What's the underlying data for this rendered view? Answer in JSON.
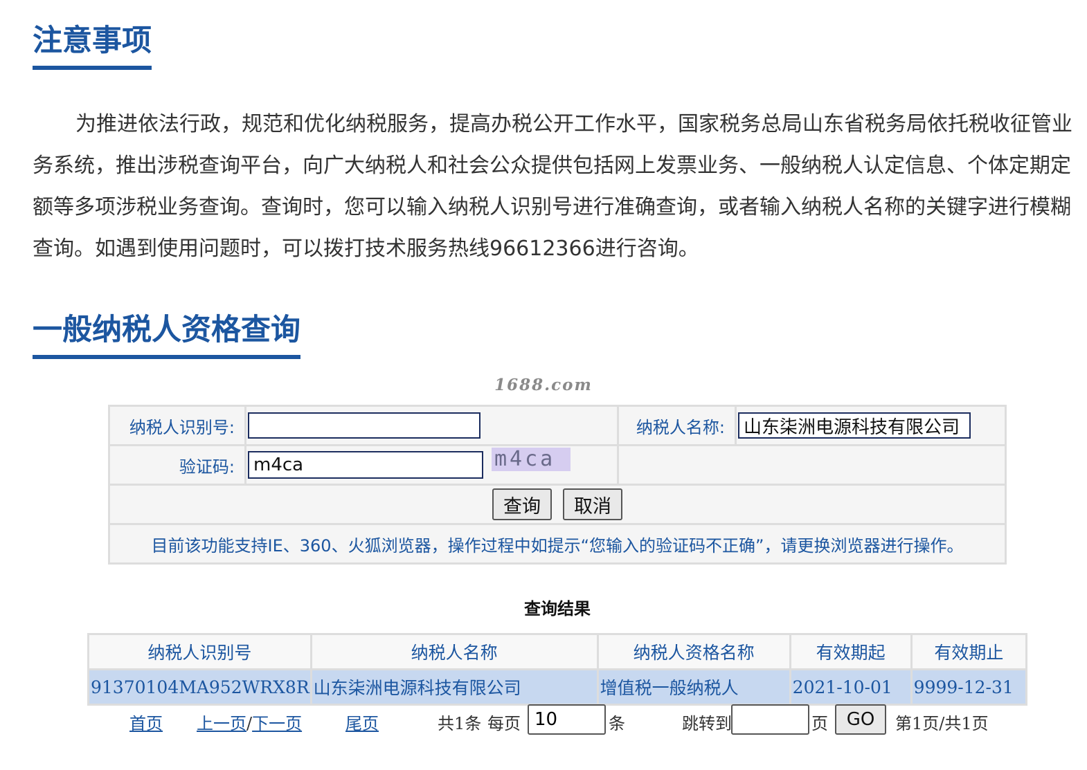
{
  "notice": {
    "title": "注意事项",
    "body": "为推进依法行政，规范和优化纳税服务，提高办税公开工作水平，国家税务总局山东省税务局依托税收征管业务系统，推出涉税查询平台，向广大纳税人和社会公众提供包括网上发票业务、一般纳税人认定信息、个体定期定额等多项涉税业务查询。查询时，您可以输入纳税人识别号进行准确查询，或者输入纳税人名称的关键字进行模糊查询。如遇到使用问题时，可以拨打技术服务热线96612366进行咨询。"
  },
  "query": {
    "title": "一般纳税人资格查询",
    "watermark": "1688.com",
    "taxpayer_id_label": "纳税人识别号:",
    "taxpayer_id_value": "",
    "taxpayer_name_label": "纳税人名称:",
    "taxpayer_name_value": "山东柒洲电源科技有限公司",
    "captcha_label": "验证码:",
    "captcha_value": "m4ca",
    "captcha_image_text": "m4ca",
    "search_button": "查询",
    "cancel_button": "取消",
    "browser_note": "目前该功能支持IE、360、火狐浏览器，操作过程中如提示“您输入的验证码不正确”，请更换浏览器进行操作。"
  },
  "results": {
    "title": "查询结果",
    "columns": [
      "纳税人识别号",
      "纳税人名称",
      "纳税人资格名称",
      "有效期起",
      "有效期止"
    ],
    "rows": [
      [
        "91370104MA952WRX8R",
        "山东柒洲电源科技有限公司",
        "增值税一般纳税人",
        "2021-10-01",
        "9999-12-31"
      ]
    ]
  },
  "pager": {
    "first": "首页",
    "prev": "上一页",
    "slash": "/",
    "next": "下一页",
    "last": "尾页",
    "total_text": "共1条",
    "per_page_label": "每页",
    "per_page_value": "10",
    "per_page_unit": "条",
    "jump_label": "跳转到",
    "jump_value": "",
    "page_unit": "页",
    "go_button": "GO",
    "page_info": "第1页/共1页"
  },
  "colors": {
    "accent": "#1c56a0",
    "row_highlight": "#c7d8f0",
    "border": "#dddddd"
  }
}
